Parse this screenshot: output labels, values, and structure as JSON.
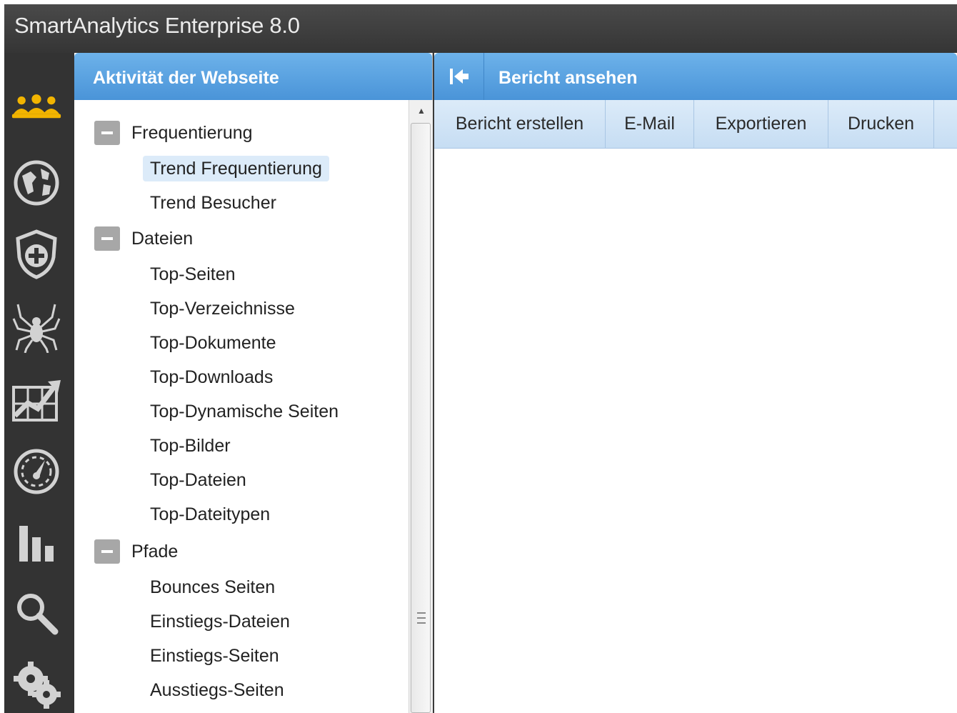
{
  "app": {
    "title": "SmartAnalytics Enterprise 8.0"
  },
  "colors": {
    "accent_blue": "#4a94d8",
    "active_icon": "#f2b400",
    "icon_gray": "#d2d2d2",
    "toolbar_blue": "#cfe3f7"
  },
  "sidebar": {
    "icons": [
      "users-icon",
      "globe-icon",
      "shield-plus-icon",
      "spider-icon",
      "trend-chart-icon",
      "speedometer-icon",
      "bar-chart-icon",
      "search-icon",
      "gears-icon"
    ],
    "active": "users-icon"
  },
  "left_panel": {
    "title": "Aktivität der Webseite",
    "groups": [
      {
        "label": "Frequentierung",
        "items": [
          "Trend Frequentierung",
          "Trend Besucher"
        ]
      },
      {
        "label": "Dateien",
        "items": [
          "Top-Seiten",
          "Top-Verzeichnisse",
          "Top-Dokumente",
          "Top-Downloads",
          "Top-Dynamische Seiten",
          "Top-Bilder",
          "Top-Dateien",
          "Top-Dateitypen"
        ]
      },
      {
        "label": "Pfade",
        "items": [
          "Bounces Seiten",
          "Einstiegs-Dateien",
          "Einstiegs-Seiten",
          "Ausstiegs-Seiten"
        ]
      }
    ],
    "selected_item": "Trend Frequentierung"
  },
  "right_panel": {
    "title": "Bericht ansehen",
    "toolbar": {
      "create": "Bericht erstellen",
      "email": "E-Mail",
      "export": "Exportieren",
      "print": "Drucken"
    }
  }
}
